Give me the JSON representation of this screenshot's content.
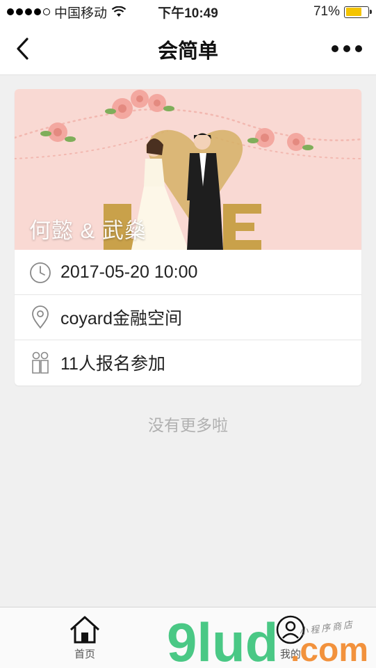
{
  "status_bar": {
    "carrier": "中国移动",
    "time": "下午10:49",
    "battery_percent": "71%",
    "battery_level": 0.71,
    "signal_icon": "signal-dots-icon",
    "wifi_icon": "wifi-icon"
  },
  "nav": {
    "title": "会简单",
    "back_icon": "chevron-left-icon",
    "more_icon": "more-dots-icon"
  },
  "event": {
    "couple_names": "何懿 & 武燊",
    "datetime": "2017-05-20 10:00",
    "location": "coyard金融空间",
    "signup": "11人报名参加",
    "icons": {
      "time": "clock-icon",
      "location": "location-pin-icon",
      "signup": "people-icon"
    }
  },
  "list_end_text": "没有更多啦",
  "tabs": [
    {
      "label": "首页",
      "icon": "home-icon"
    },
    {
      "label": "我的",
      "icon": "user-icon"
    }
  ],
  "watermark": {
    "text": "9lud.com",
    "note": "小程序商店"
  },
  "colors": {
    "banner_bg": "#f9d9d3",
    "accent_gold": "#c9a14a",
    "battery_fill": "#f4c400",
    "watermark_green": "#3cc47c",
    "watermark_orange": "#f28a2e"
  }
}
